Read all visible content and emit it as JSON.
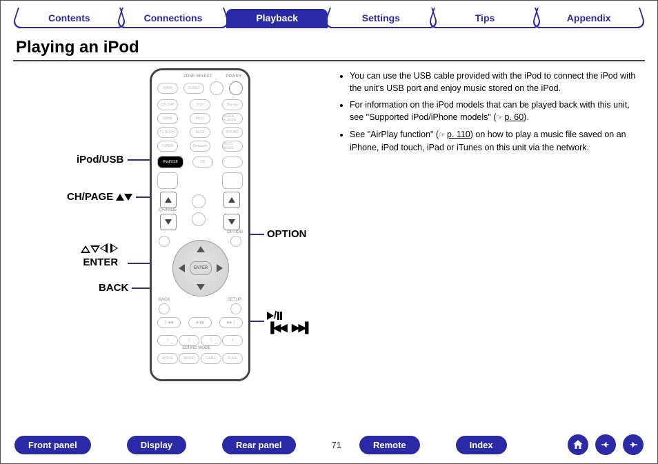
{
  "tabs": [
    "Contents",
    "Connections",
    "Playback",
    "Settings",
    "Tips",
    "Appendix"
  ],
  "active_tab_index": 2,
  "title": "Playing an iPod",
  "callouts": {
    "ipod_usb": "iPod/USB",
    "ch_page": "CH/PAGE",
    "enter_line1_label": "ENTER",
    "back": "BACK",
    "option": "OPTION"
  },
  "notes": {
    "b1": "You can use the USB cable provided with the iPod to connect the iPod with the unit's USB port and enjoy music stored on the iPod.",
    "b2a": "For information on the iPod models that can be played back with this unit, see \"Supported iPod/iPhone models\"  (",
    "b2_link": "p. 60",
    "b2b": ").",
    "b3a": "See \"AirPlay function\" (",
    "b3_link": "p. 110",
    "b3b": ") on how to play a music file saved on an iPhone, iPod touch, iPad or iTunes on this unit via the network."
  },
  "footer": {
    "buttons": [
      "Front panel",
      "Display",
      "Rear panel",
      "Remote",
      "Index"
    ],
    "page_no": "71"
  },
  "remote": {
    "ipod_btn": "iPod/USB",
    "enter_btn": "ENTER",
    "ch_lbl": "CH/PAGE",
    "back_lbl": "BACK",
    "option_lbl": "OPTION",
    "setup_lbl": "SETUP"
  }
}
